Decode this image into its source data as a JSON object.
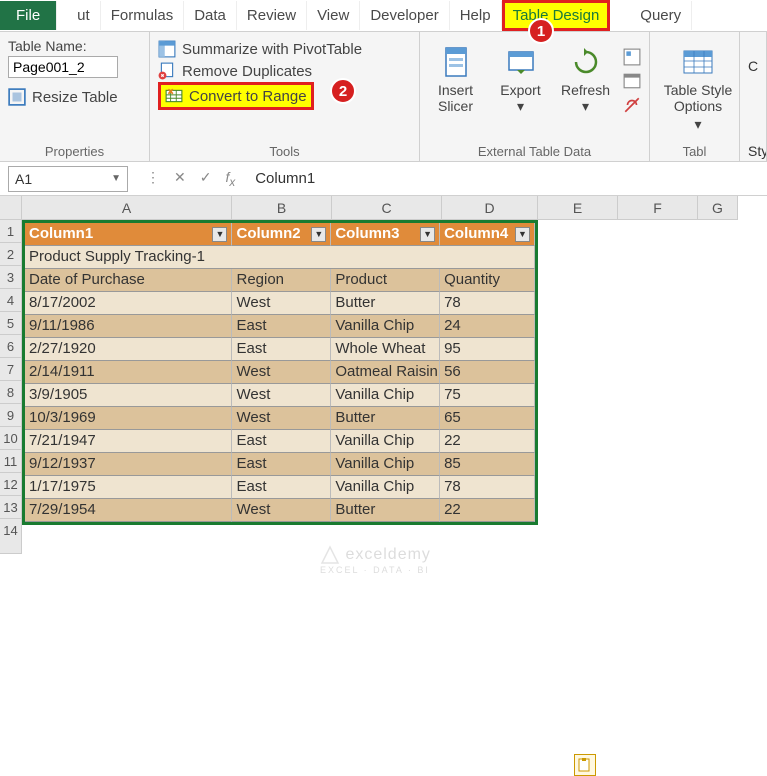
{
  "tabs": {
    "file": "File",
    "cut": "ut",
    "formulas": "Formulas",
    "data": "Data",
    "review": "Review",
    "view": "View",
    "developer": "Developer",
    "help": "Help",
    "tableDesign": "Table Design",
    "query": "Query"
  },
  "ribbon": {
    "properties": {
      "label": "Properties",
      "tableNameLabel": "Table Name:",
      "tableName": "Page001_2",
      "resize": "Resize Table"
    },
    "tools": {
      "label": "Tools",
      "pivot": "Summarize with PivotTable",
      "dup": "Remove Duplicates",
      "convert": "Convert to Range"
    },
    "extData": {
      "label": "External Table Data",
      "insertSlicer": "Insert\nSlicer",
      "export": "Export",
      "refresh": "Refresh"
    },
    "styleOpts": {
      "tso": "Table Style\nOptions",
      "tabl": "Tabl",
      "ts": "Styl",
      "c": "C"
    }
  },
  "nameBox": "A1",
  "formulaBar": "Column1",
  "colHeaders": [
    "A",
    "B",
    "C",
    "D",
    "E",
    "F",
    "G"
  ],
  "rowHeaders": [
    "1",
    "2",
    "3",
    "4",
    "5",
    "6",
    "7",
    "8",
    "9",
    "10",
    "11",
    "12",
    "13",
    "14"
  ],
  "table": {
    "headers": [
      "Column1",
      "Column2",
      "Column3",
      "Column4"
    ],
    "title": "Product Supply Tracking-1",
    "subheads": [
      "Date of Purchase",
      "Region",
      "Product",
      "Quantity"
    ],
    "rows": [
      [
        "8/17/2002",
        "West",
        "Butter",
        "78"
      ],
      [
        "9/11/1986",
        "East",
        "Vanilla Chip",
        "24"
      ],
      [
        "2/27/1920",
        "East",
        "Whole Wheat",
        "95"
      ],
      [
        "2/14/1911",
        "West",
        "Oatmeal Raisin",
        "56"
      ],
      [
        "3/9/1905",
        "West",
        "Vanilla Chip",
        "75"
      ],
      [
        "10/3/1969",
        "West",
        "Butter",
        "65"
      ],
      [
        "7/21/1947",
        "East",
        "Vanilla Chip",
        "22"
      ],
      [
        "9/12/1937",
        "East",
        "Vanilla Chip",
        "85"
      ],
      [
        "1/17/1975",
        "East",
        "Vanilla Chip",
        "78"
      ],
      [
        "7/29/1954",
        "West",
        "Butter",
        "22"
      ]
    ]
  },
  "watermark": {
    "main": "exceldemy",
    "sub": "EXCEL · DATA · BI"
  },
  "badges": {
    "one": "1",
    "two": "2"
  }
}
